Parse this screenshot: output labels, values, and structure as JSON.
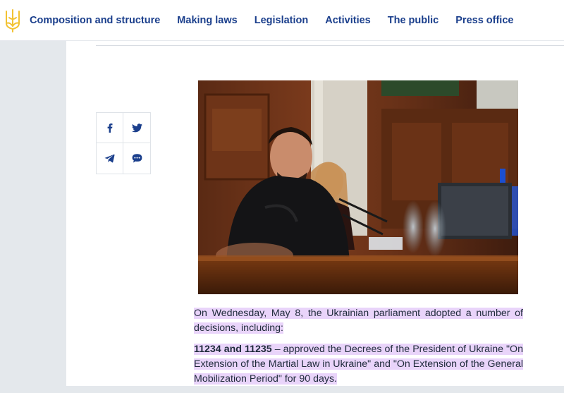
{
  "header": {
    "logo_icon": "trident-icon",
    "nav": [
      {
        "label": "Composition and structure"
      },
      {
        "label": "Making laws"
      },
      {
        "label": "Legislation"
      },
      {
        "label": "Activities"
      },
      {
        "label": "The public"
      },
      {
        "label": "Press office"
      }
    ]
  },
  "share": {
    "icons": [
      "facebook-icon",
      "twitter-icon",
      "telegram-icon",
      "chat-icon"
    ]
  },
  "article": {
    "p1": "On Wednesday, May 8, the Ukrainian parliament adopted a number of decisions, including:",
    "p2_bold": "11234 and 11235",
    "p2_rest": " – approved the Decrees of the President of Ukraine \"On Extension of the Martial Law in Ukraine\" and \"On Extension of the General Mobilization Period\" for 90 days."
  },
  "colors": {
    "nav_text": "#1b3f8c",
    "highlight": "#e9d4fa",
    "sidebar_bg": "#e4e8ec",
    "trident_gold": "#f2c232"
  }
}
